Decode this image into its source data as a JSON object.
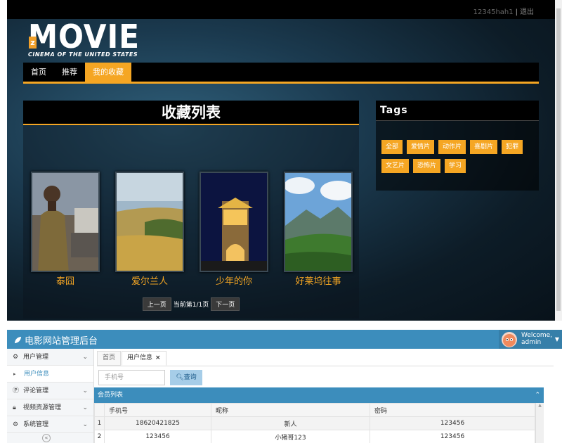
{
  "site": {
    "user": {
      "name": "12345hah1",
      "logout": "退出"
    },
    "logo": {
      "big": "MOVIE",
      "letter": "z",
      "sub": "CINEMA OF THE UNITED STATES"
    },
    "nav": [
      {
        "label": "首页",
        "active": false
      },
      {
        "label": "推荐",
        "active": false
      },
      {
        "label": "我的收藏",
        "active": true
      }
    ],
    "favorites": {
      "title": "收藏列表",
      "items": [
        {
          "title": "泰囧",
          "art": "person-desert"
        },
        {
          "title": "爱尔兰人",
          "art": "grassland"
        },
        {
          "title": "少年的你",
          "art": "night-tower"
        },
        {
          "title": "好莱坞往事",
          "art": "mountains"
        }
      ],
      "pager": {
        "prev": "上一页",
        "info": "当前第1/1页",
        "next": "下一页"
      }
    },
    "tags": {
      "title": "Tags",
      "items": [
        "全部",
        "爱情片",
        "动作片",
        "喜剧片",
        "犯罪",
        "文艺片",
        "恐怖片",
        "学习"
      ]
    }
  },
  "admin": {
    "brand": "电影网站管理后台",
    "welcome": "Welcome,",
    "user": "admin",
    "sidebar": [
      {
        "label": "用户管理",
        "icon": "gears-icon",
        "open": true
      },
      {
        "label": "用户信息",
        "sub": true
      },
      {
        "label": "评论管理",
        "icon": "p-icon"
      },
      {
        "label": "视频资源管理",
        "icon": "lock-icon"
      },
      {
        "label": "系统管理",
        "icon": "gears-icon"
      }
    ],
    "tabs": [
      {
        "label": "首页",
        "active": false
      },
      {
        "label": "用户信息",
        "active": true,
        "close": "×"
      }
    ],
    "search": {
      "placeholder": "手机号",
      "button": "查询"
    },
    "table": {
      "title": "会员列表",
      "columns": [
        "手机号",
        "昵称",
        "密码"
      ],
      "rows": [
        {
          "num": "1",
          "phone": "18620421825",
          "nick": "新人",
          "pwd": "123456"
        },
        {
          "num": "2",
          "phone": "123456",
          "nick": "小猪哥123",
          "pwd": "123456"
        }
      ]
    }
  },
  "colors": {
    "accent": "#f5a623",
    "admin_blue": "#3c8dbc"
  }
}
